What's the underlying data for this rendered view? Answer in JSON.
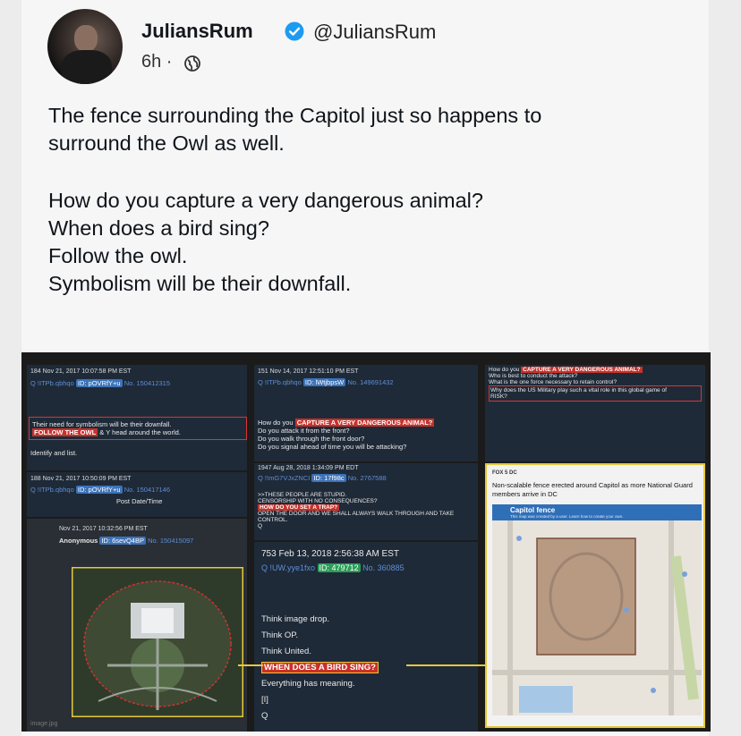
{
  "post": {
    "display_name": "JuliansRum",
    "handle": "@JuliansRum",
    "time": "6h ·",
    "lines": [
      "The fence surrounding the Capitol just so happens to",
      "surround the Owl as well."
    ],
    "questions": [
      "How do you capture a very dangerous animal?",
      "When does a bird sing?",
      "Follow the owl.",
      "Symbolism will be their downfall."
    ]
  },
  "collage": {
    "left": {
      "p1_header": "184 Nov 21, 2017 10:07:58 PM EST",
      "p1_id": "Q !ITPb.qbhqo",
      "p1_idtag": "ID: pOVRfY+u",
      "p1_no": "No. 150412315",
      "p1_line1": "Their need for symbolism will be their downfall.",
      "p1_follow": "FOLLOW THE OWL",
      "p1_line2": "& Y head around the world.",
      "p1_line3": "Identify and list.",
      "p2_header": "188 Nov 21, 2017 10:50:09 PM EST",
      "p2_id": "Q !ITPb.qbhqo",
      "p2_idtag": "ID: pOVRfY+u",
      "p2_no": "No. 150417146",
      "p2_line": "Post Date/Time",
      "p3_header": "Nov 21, 2017 10:32:56 PM EST",
      "p3_id": "Anonymous",
      "p3_idtag": "ID: 6sevQ4BP",
      "p3_no": "No. 150415097",
      "caption": "image.jpg"
    },
    "middle": {
      "p1_header": "151 Nov 14, 2017 12:51:10 PM EST",
      "p1_id": "Q !ITPb.qbhqo",
      "p1_idtag": "ID: lWtjbpsW",
      "p1_no": "No. 149691432",
      "q_prefix": "How do you",
      "q_red": "CAPTURE A VERY DANGEROUS ANIMAL?",
      "q_lines": [
        "Do you attack it from the front?",
        "Do you walk through the front door?",
        "Do you signal ahead of time you will be attacking?"
      ],
      "p2_header": "1947 Aug 28, 2018 1:34:09 PM EDT",
      "p2_id": "Q !!mG7VJxZNCI",
      "p2_idtag": "ID: 17f98c",
      "p2_no": "No. 2767588",
      "p2_line1": ">>THESE PEOPLE ARE STUPID.",
      "p2_line2": "CENSORSHIP WITH NO CONSEQUENCES?",
      "p2_red": "HOW DO YOU SET A TRAP?",
      "p2_line3": "OPEN THE DOOR AND WE SHALL ALWAYS WALK THROUGH AND TAKE CONTROL.",
      "p2_sig": "Q",
      "p3_header": "753  Feb 13, 2018 2:56:38 AM EST",
      "p3_id": "Q !UW.yye1fxo",
      "p3_idtag": "ID: 479712",
      "p3_no": "No. 360885",
      "p3_lines": [
        "Think image drop.",
        "Think OP.",
        "Think United."
      ],
      "p3_red": "WHEN DOES A BIRD SING?",
      "p3_line4": "Everything has meaning.",
      "p3_line5": "[I]",
      "p3_sig": "Q"
    },
    "right": {
      "q_prefix": "How do you",
      "q_red": "CAPTURE A VERY DANGEROUS ANIMAL?",
      "q_lines": [
        "Who is best to conduct the attack?",
        "What is the one force necessary to retain control?",
        "Why does the US Military play such a vital role in this global game of"
      ],
      "q_last": "RISK?",
      "news_src": "FOX 5 DC",
      "news_title": "Non-scalable fence erected around Capitol as more National Guard members arrive in DC",
      "map_title": "Capitol fence",
      "map_sub": "This map was created by a user. Learn how to create your own."
    }
  },
  "colors": {
    "verified": "#1d9bf0",
    "highlight": "#e6c83a",
    "panel_bg": "#1f2a38",
    "red": "#c8312a"
  },
  "icons": [
    "verified-badge-icon",
    "globe-icon"
  ]
}
